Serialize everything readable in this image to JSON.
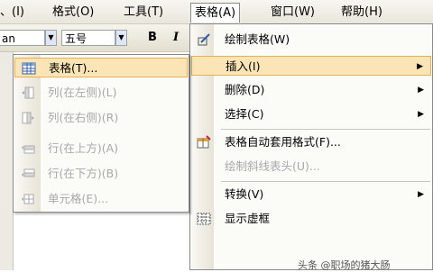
{
  "menubar": {
    "items": [
      "、(I)",
      "格式(O)",
      "工具(T)",
      "表格(A)",
      "窗口(W)",
      "帮助(H)"
    ]
  },
  "toolbar": {
    "font_name": "an",
    "font_size": "五号",
    "bold": "B",
    "italic": "I"
  },
  "table_menu": {
    "items": [
      {
        "label": "绘制表格(W)",
        "icon": "pencil-icon"
      },
      {
        "label": "插入(I)",
        "has_submenu": true,
        "highlighted": true
      },
      {
        "label": "删除(D)",
        "has_submenu": true
      },
      {
        "label": "选择(C)",
        "has_submenu": true
      },
      {
        "label": "表格自动套用格式(F)...",
        "icon": "autoformat-icon"
      },
      {
        "label": "绘制斜线表头(U)...",
        "disabled": true
      },
      {
        "label": "转换(V)",
        "has_submenu": true
      },
      {
        "label": "显示虚框",
        "icon": "gridlines-icon"
      }
    ]
  },
  "insert_submenu": {
    "items": [
      {
        "label": "表格(T)...",
        "icon": "table-icon",
        "highlighted": true
      },
      {
        "label": "列(在左侧)(L)",
        "icon": "col-left-icon",
        "disabled": true
      },
      {
        "label": "列(在右侧)(R)",
        "icon": "col-right-icon",
        "disabled": true
      },
      {
        "label": "行(在上方)(A)",
        "icon": "row-above-icon",
        "disabled": true
      },
      {
        "label": "行(在下方)(B)",
        "icon": "row-below-icon",
        "disabled": true
      },
      {
        "label": "单元格(E)...",
        "icon": "cell-icon",
        "disabled": true
      }
    ]
  },
  "watermark": "头条 @职场的猪大肠",
  "colors": {
    "highlight": "#fbe5b6",
    "highlight_border": "#e8b04f",
    "menu_border": "#8a8a8a"
  }
}
